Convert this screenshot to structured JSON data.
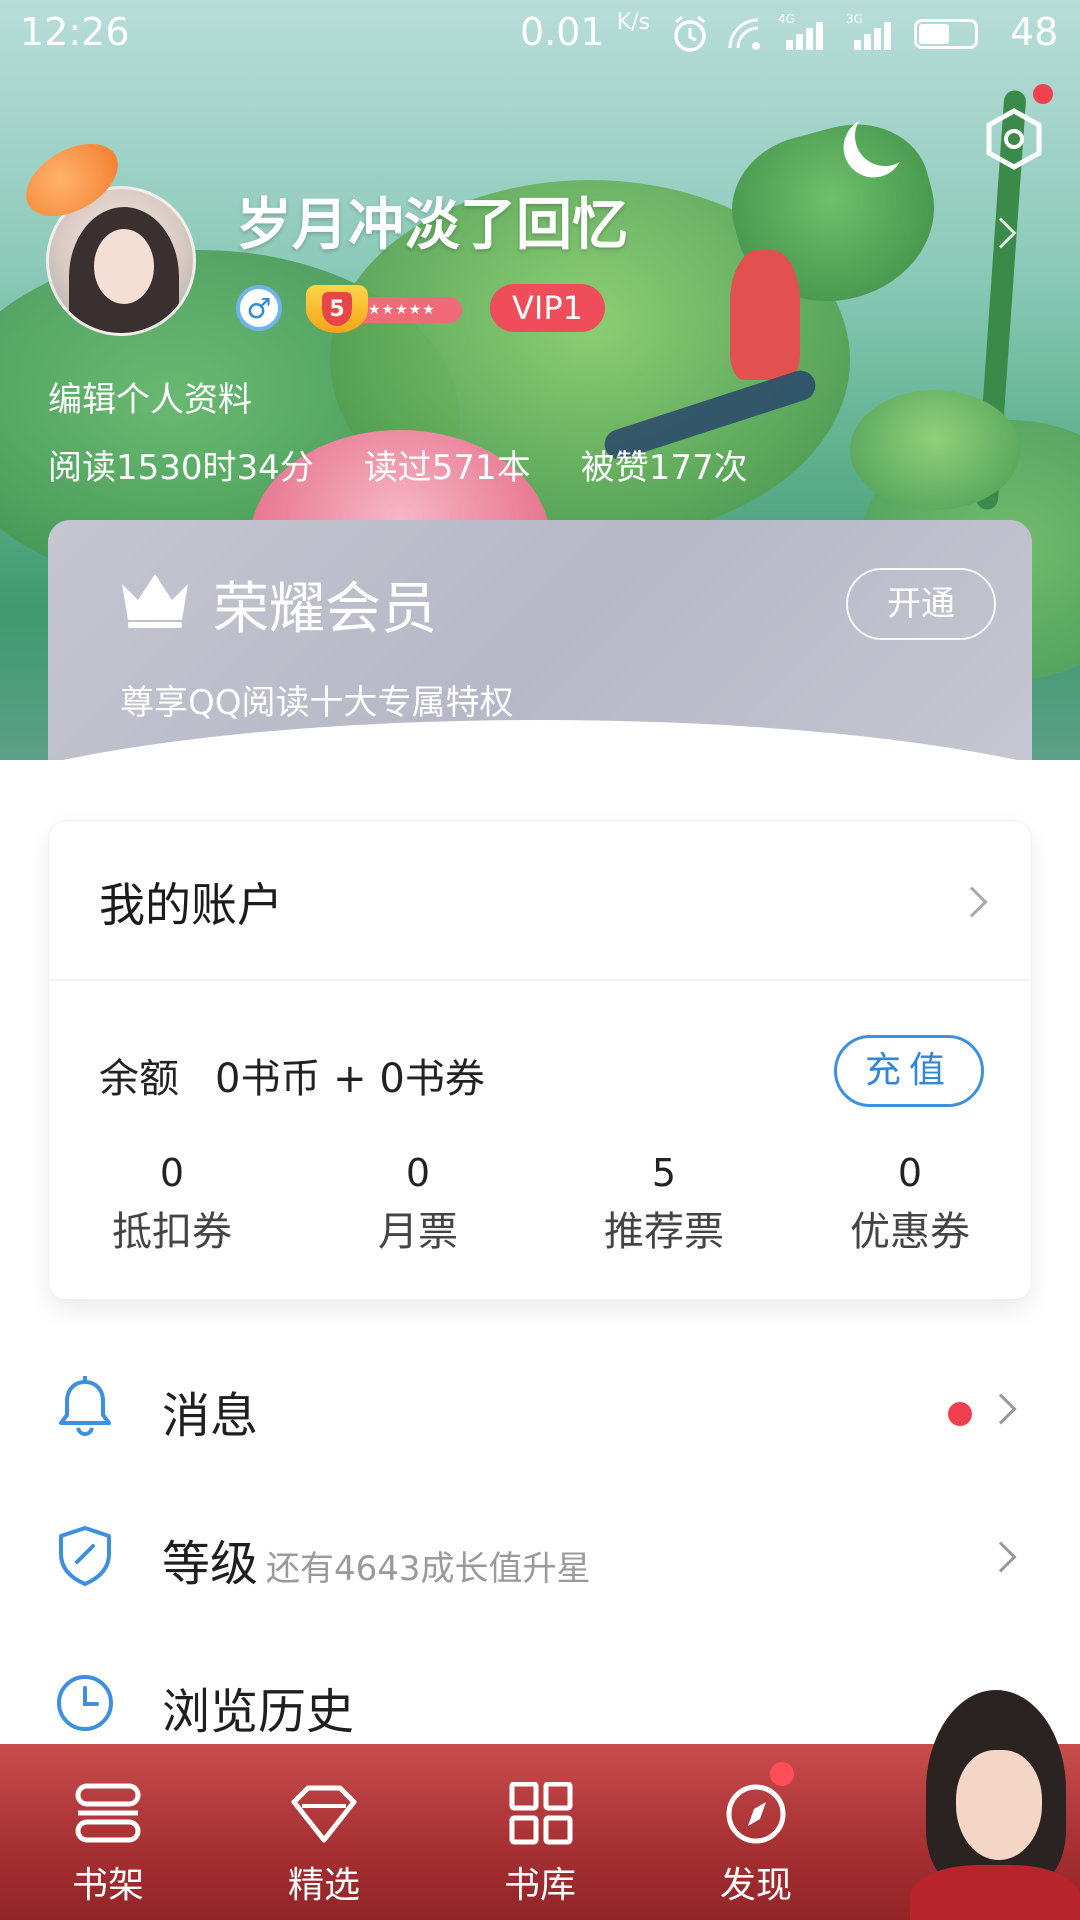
{
  "status_bar": {
    "time": "12:26",
    "net_speed": "0.01",
    "net_unit": "K/s",
    "signal1_label": "4G",
    "signal2_label": "3G",
    "battery": "48"
  },
  "profile": {
    "username": "岁月冲淡了回忆",
    "gender_symbol": "♂",
    "level": "5",
    "level_stars": "★★★★★",
    "vip_label": "VIP1",
    "edit_profile": "编辑个人资料",
    "stats": {
      "read_time": "阅读1530时34分",
      "books_read": "读过571本",
      "likes": "被赞177次"
    }
  },
  "member_card": {
    "title": "荣耀会员",
    "subtitle": "尊享QQ阅读十大专属特权",
    "open_button": "开通"
  },
  "account": {
    "title": "我的账户",
    "balance_label": "余额",
    "balance_value": "0书币 + 0书券",
    "recharge_button": "充值",
    "stats": [
      {
        "value": "0",
        "label": "抵扣券"
      },
      {
        "value": "0",
        "label": "月票"
      },
      {
        "value": "5",
        "label": "推荐票"
      },
      {
        "value": "0",
        "label": "优惠券"
      }
    ]
  },
  "menu": {
    "messages": {
      "label": "消息"
    },
    "level": {
      "label": "等级",
      "subtitle": "还有4643成长值升星"
    },
    "history": {
      "label": "浏览历史"
    }
  },
  "tabs": [
    {
      "label": "书架",
      "icon": "bookshelf-icon"
    },
    {
      "label": "精选",
      "icon": "diamond-icon"
    },
    {
      "label": "书库",
      "icon": "grid-icon"
    },
    {
      "label": "发现",
      "icon": "compass-icon"
    }
  ],
  "colors": {
    "accent_blue": "#2f86db",
    "vip_red": "#ef4d5a",
    "tabbar_red": "#a52f32",
    "notification_red": "#ef3f4d"
  }
}
